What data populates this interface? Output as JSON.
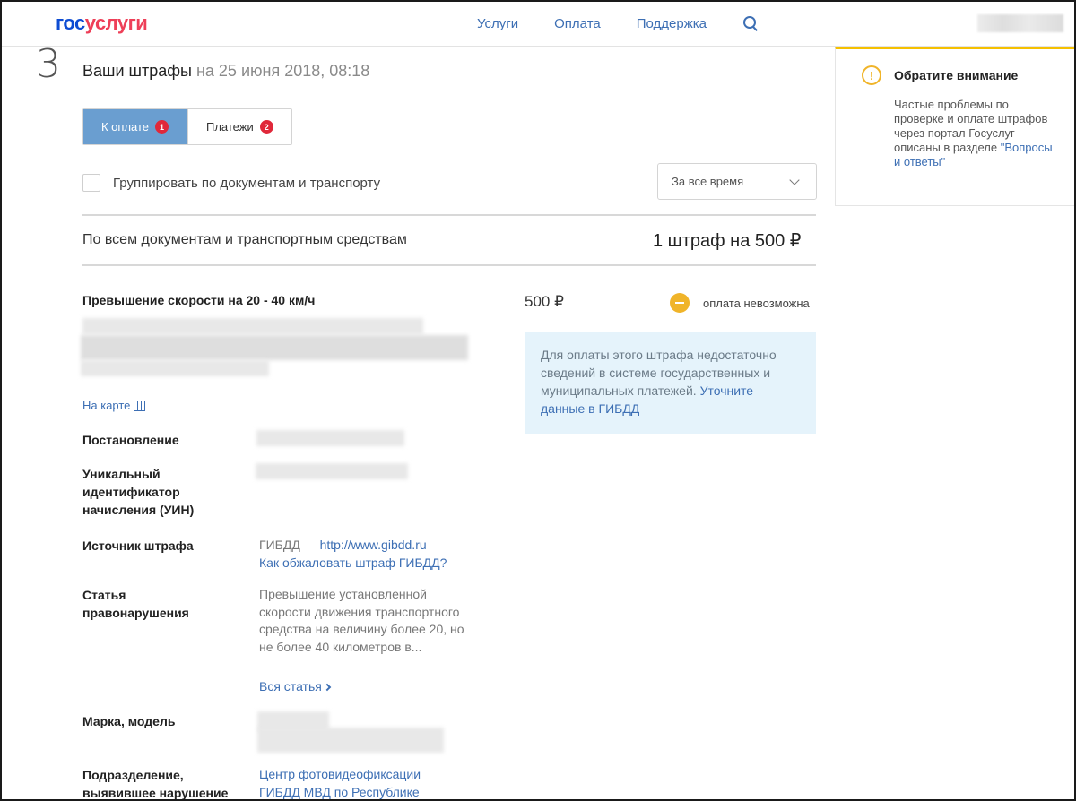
{
  "header": {
    "logo_part1": "гос",
    "logo_part2": "услуги",
    "nav": [
      "Услуги",
      "Оплата",
      "Поддержка"
    ]
  },
  "page": {
    "step": "3",
    "title": "Ваши штрафы",
    "title_date": " на 25 июня 2018, 08:18"
  },
  "tabs": [
    {
      "label": "К оплате",
      "badge": "1"
    },
    {
      "label": "Платежи",
      "badge": "2"
    }
  ],
  "filters": {
    "group_label": "Группировать по документам и транспорту",
    "period": "За все время"
  },
  "summary": {
    "left": "По всем документам и транспортным средствам",
    "right": "1 штраф на 500 ₽"
  },
  "fine": {
    "title": "Превышение скорости на 20 - 40 км/ч",
    "amount": "500 ₽",
    "status": "оплата невозможна",
    "map_link": "На карте",
    "info_text": "Для оплаты этого штрафа недостаточно сведений в системе государственных и муниципальных платежей.",
    "info_link": "Уточните данные в ГИБДД",
    "fields": {
      "resolution_label": "Постановление",
      "uin_label": "Уникальный идентификатор начисления (УИН)",
      "source_label": "Источник штрафа",
      "source_name": "ГИБДД",
      "source_url": "http://www.gibdd.ru",
      "appeal_link": "Как обжаловать штраф ГИБДД?",
      "article_label": "Статья правонарушения",
      "article_text": "Превышение установленной скорости движения транспортного средства на величину более 20, но не более 40 километров в...",
      "article_more": "Вся статья",
      "car_label": "Марка, модель",
      "division_label": "Подразделение, выявившее нарушение",
      "division_value": "Центр фотовидеофиксации ГИБДД МВД по Республике"
    }
  },
  "notice": {
    "title": "Обратите внимание",
    "text": "Частые проблемы по проверке и оплате штрафов через портал Госуслуг описаны в разделе ",
    "link": "\"Вопросы и ответы\""
  }
}
